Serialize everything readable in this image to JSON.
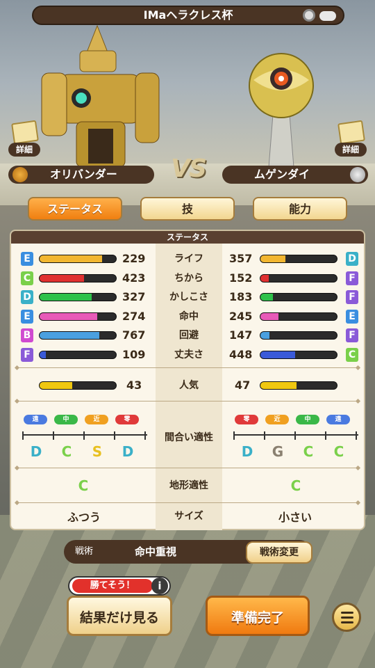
{
  "header": {
    "title": "IMaヘラクレス杯"
  },
  "left_player": {
    "detail_label": "詳細",
    "name": "オリバンダー"
  },
  "right_player": {
    "detail_label": "詳細",
    "name": "ムゲンダイ"
  },
  "vs_label": "VS",
  "tabs": [
    {
      "label": "ステータス",
      "active": true
    },
    {
      "label": "技",
      "active": false
    },
    {
      "label": "能力",
      "active": false
    }
  ],
  "panel_title": "ステータス",
  "stats": [
    {
      "label": "ライフ",
      "left_rank": "E",
      "left_value": "229",
      "left_fill": 0.82,
      "right_rank": "D",
      "right_value": "357",
      "right_fill": 0.33,
      "color": "#f2b630"
    },
    {
      "label": "ちから",
      "left_rank": "C",
      "left_value": "423",
      "left_fill": 0.58,
      "right_rank": "F",
      "right_value": "152",
      "right_fill": 0.11,
      "color": "#e03030"
    },
    {
      "label": "かしこさ",
      "left_rank": "D",
      "left_value": "327",
      "left_fill": 0.68,
      "right_rank": "F",
      "right_value": "183",
      "right_fill": 0.16,
      "color": "#2ec14a"
    },
    {
      "label": "命中",
      "left_rank": "E",
      "left_value": "274",
      "left_fill": 0.75,
      "right_rank": "E",
      "right_value": "245",
      "right_fill": 0.24,
      "color": "#e85ab8"
    },
    {
      "label": "回避",
      "left_rank": "B",
      "left_value": "767",
      "left_fill": 0.78,
      "right_rank": "F",
      "right_value": "147",
      "right_fill": 0.12,
      "color": "#4aa0e0"
    },
    {
      "label": "丈夫さ",
      "left_rank": "F",
      "left_value": "109",
      "left_fill": 0.08,
      "right_rank": "C",
      "right_value": "448",
      "right_fill": 0.45,
      "color": "#3a5ad8"
    }
  ],
  "rank_colors": {
    "B": "#d04ad0",
    "C": "#7ad04a",
    "D": "#3ab0c8",
    "E": "#3a8ee0",
    "F": "#8a5ad8",
    "G": "#8a8070",
    "S": "#e8c020"
  },
  "popularity": {
    "label": "人気",
    "left_value": "43",
    "left_fill": 0.43,
    "right_value": "47",
    "right_fill": 0.47,
    "color": "#f0c810"
  },
  "range": {
    "label": "間合い適性",
    "left_pills": [
      {
        "text": "遠",
        "color": "#4a7ae0"
      },
      {
        "text": "中",
        "color": "#3ab848"
      },
      {
        "text": "近",
        "color": "#f0a020"
      },
      {
        "text": "零",
        "color": "#e03a3a"
      }
    ],
    "right_pills": [
      {
        "text": "零",
        "color": "#e03a3a"
      },
      {
        "text": "近",
        "color": "#f0a020"
      },
      {
        "text": "中",
        "color": "#3ab848"
      },
      {
        "text": "遠",
        "color": "#4a7ae0"
      }
    ],
    "left_ranks": [
      "D",
      "C",
      "S",
      "D"
    ],
    "right_ranks": [
      "D",
      "G",
      "C",
      "C"
    ]
  },
  "terrain": {
    "label": "地形適性",
    "left_rank": "C",
    "right_rank": "C"
  },
  "size": {
    "label": "サイズ",
    "left_value": "ふつう",
    "right_value": "小さい"
  },
  "tactics": {
    "label": "戦術",
    "value": "命中重視",
    "button": "戦術変更"
  },
  "bubble": {
    "text": "勝てそう！",
    "info": "i"
  },
  "buttons": {
    "result": "結果だけ見る",
    "ready": "準備完了"
  }
}
